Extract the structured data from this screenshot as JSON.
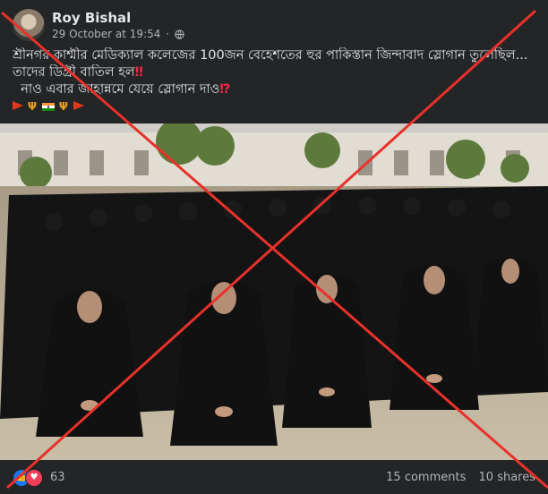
{
  "post": {
    "author": "Roy Bishal",
    "timestamp": "29 October at 19:54",
    "separator": "·",
    "audience_icon": "globe-icon",
    "text_line1": "শ্রীনগর কাশ্মীর মেডিক্যাল কলেজের 100জন বেহেশতের হুর পাকিস্তান জিন্দাবাদ স্লোগান তুলেছিল...",
    "text_line2": "তাদের ডিগ্রী বাতিল হল",
    "text_line2_mark": "‼",
    "text_line3": "নাও এবার জাহান্নমে যেয়ে স্লোগান দাও",
    "text_line3_mark": "⁉",
    "emoji_row": [
      "red-pennant",
      "trident",
      "indian-flag",
      "trident",
      "red-pennant"
    ]
  },
  "reactions": {
    "count": "63",
    "icons": [
      "like-icon",
      "love-icon"
    ]
  },
  "stats": {
    "comments": "15 comments",
    "shares": "10 shares"
  },
  "overlay": {
    "type": "red-cross-mark",
    "color": "#e8312a"
  },
  "colors": {
    "background": "#242526",
    "text_primary": "#e4e6eb",
    "text_secondary": "#b0b3b8"
  }
}
